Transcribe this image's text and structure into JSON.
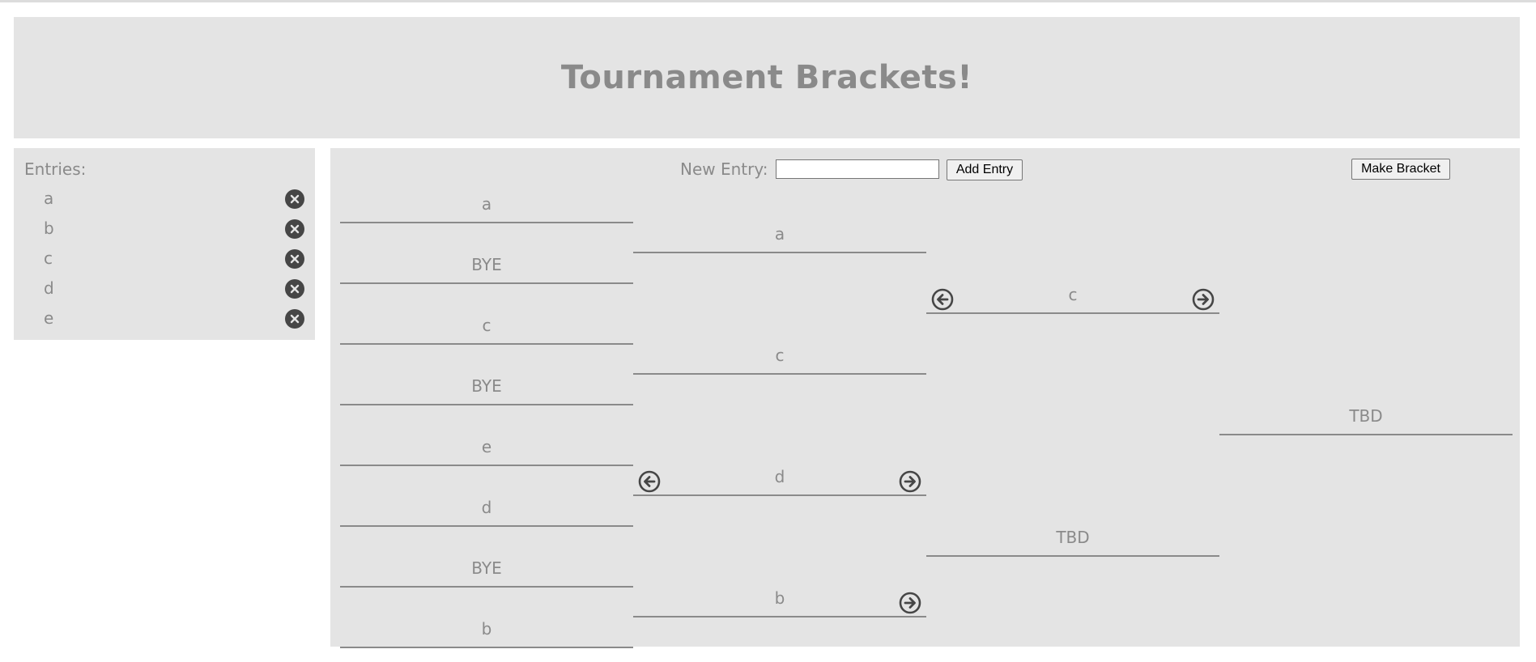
{
  "header": {
    "title": "Tournament Brackets!"
  },
  "entries": {
    "title": "Entries:",
    "items": [
      {
        "name": "a"
      },
      {
        "name": "b"
      },
      {
        "name": "c"
      },
      {
        "name": "d"
      },
      {
        "name": "e"
      }
    ]
  },
  "controls": {
    "new_entry_label": "New Entry:",
    "new_entry_value": "",
    "add_entry_label": "Add Entry",
    "make_bracket_label": "Make Bracket"
  },
  "bracket": {
    "round1": [
      "a",
      "BYE",
      "c",
      "BYE",
      "e",
      "d",
      "BYE",
      "b"
    ],
    "round2": [
      "a",
      "c",
      "d",
      "b"
    ],
    "round3": [
      "c",
      "TBD"
    ],
    "round4": [
      "TBD"
    ]
  },
  "icons": {
    "remove": "close-icon",
    "advance_left": "arrow-left-circle-icon",
    "advance_right": "arrow-right-circle-icon"
  },
  "colors": {
    "panel_bg": "#e4e4e4",
    "text": "#8a8a8a",
    "icon": "#464646"
  }
}
